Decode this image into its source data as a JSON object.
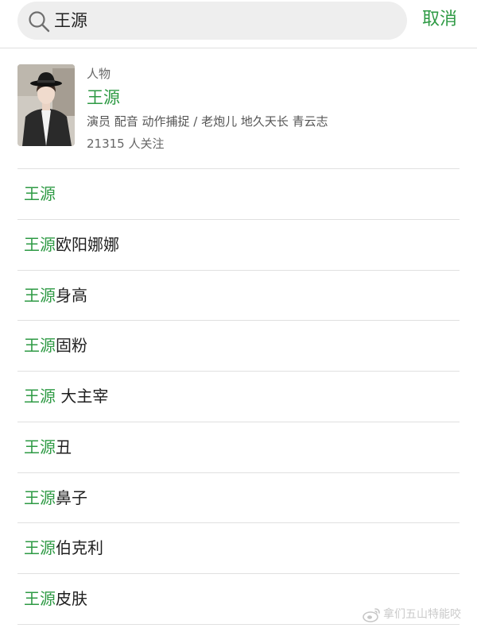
{
  "search": {
    "query": "王源",
    "cancel_label": "取消"
  },
  "profile_card": {
    "category": "人物",
    "name": "王源",
    "tags": "演员 配音 动作捕捉 / 老炮儿 地久天长 青云志",
    "followers": "21315 人关注"
  },
  "suggestions": [
    {
      "highlight": "王源",
      "rest": ""
    },
    {
      "highlight": "王源",
      "rest": "欧阳娜娜"
    },
    {
      "highlight": "王源",
      "rest": "身高"
    },
    {
      "highlight": "王源",
      "rest": "固粉"
    },
    {
      "highlight": "王源",
      "rest": " 大主宰"
    },
    {
      "highlight": "王源",
      "rest": "丑"
    },
    {
      "highlight": "王源",
      "rest": "鼻子"
    },
    {
      "highlight": "王源",
      "rest": "伯克利"
    },
    {
      "highlight": "王源",
      "rest": "皮肤"
    }
  ],
  "watermark": {
    "text": "拿们五山特能咬"
  },
  "colors": {
    "accent": "#2e9a44",
    "search_bg": "#eeeeee",
    "divider": "#e0e0e0",
    "text_primary": "#1f1f1f",
    "text_secondary": "#666666"
  },
  "icons": {
    "search": "search-icon",
    "watermark_logo": "weibo-logo-icon"
  }
}
